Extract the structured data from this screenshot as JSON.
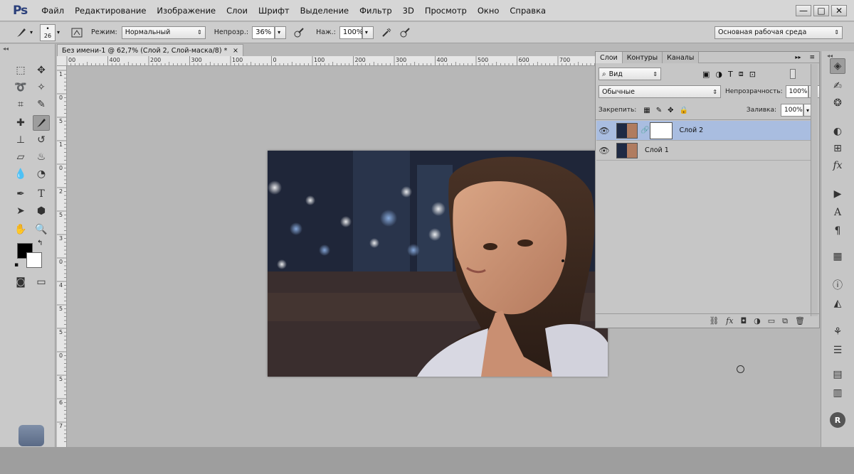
{
  "menubar": {
    "logo": "Ps",
    "items": [
      "Файл",
      "Редактирование",
      "Изображение",
      "Слои",
      "Шрифт",
      "Выделение",
      "Фильтр",
      "3D",
      "Просмотр",
      "Окно",
      "Справка"
    ],
    "window_buttons": [
      "—",
      "□",
      "✕"
    ]
  },
  "options": {
    "brush_size": "26",
    "mode_label": "Режим:",
    "mode_value": "Нормальный",
    "opacity_label": "Непрозр.:",
    "opacity_value": "36%",
    "flow_label": "Наж.:",
    "flow_value": "100%",
    "workspace": "Основная рабочая среда"
  },
  "document": {
    "tab_title": "Без имени-1 @ 62,7% (Слой 2, Слой-маска/8) *",
    "close": "×",
    "ruler_h": [
      "00",
      "400",
      "200",
      "300",
      "100",
      "0",
      "100",
      "200",
      "300",
      "400",
      "500",
      "600",
      "700"
    ],
    "ruler_v": [
      "1",
      "0",
      "5",
      "1",
      "0",
      "2",
      "5",
      "3",
      "0",
      "4",
      "5",
      "5",
      "0",
      "5",
      "6",
      "7"
    ]
  },
  "layers_panel": {
    "tabs": [
      "Слои",
      "Контуры",
      "Каналы"
    ],
    "filter_label": "Вид",
    "blend_mode": "Обычные",
    "opacity_label": "Непрозрачность:",
    "opacity_value": "100%",
    "lock_label": "Закрепить:",
    "fill_label": "Заливка:",
    "fill_value": "100%",
    "layers": [
      {
        "name": "Слой 2",
        "selected": true
      },
      {
        "name": "Слой 1",
        "selected": false
      }
    ],
    "footer_icons": [
      "link-icon",
      "fx-icon",
      "mask-icon",
      "adjustment-icon",
      "folder-icon",
      "new-layer-icon",
      "trash-icon"
    ]
  },
  "colors": {
    "accent_selected": "#a9bde0",
    "foreground": "#000000",
    "background": "#ffffff"
  }
}
